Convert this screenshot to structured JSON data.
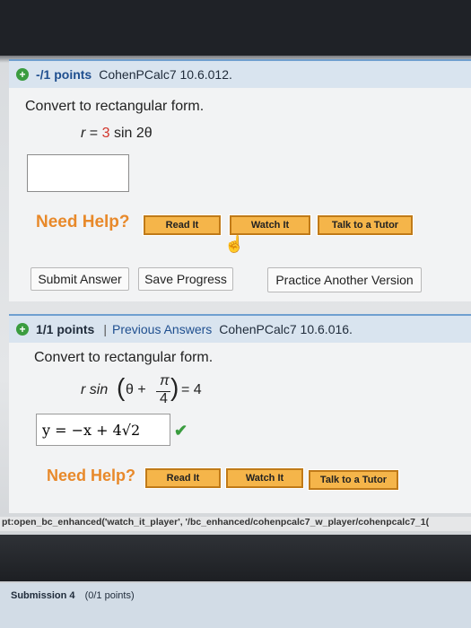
{
  "q1": {
    "points": "-/1 points",
    "course_code": "CohenPCalc7 10.6.012.",
    "question": "Convert to rectangular form.",
    "eq_r": "r",
    "eq_equals": "=",
    "eq_value": "3",
    "eq_func": "sin 2θ",
    "answer_value": "",
    "need_help": "Need Help?",
    "read_it": "Read It",
    "watch_it": "Watch It",
    "talk_tutor": "Talk to a Tutor",
    "submit": "Submit Answer",
    "save": "Save Progress",
    "practice": "Practice Another Version"
  },
  "q2": {
    "points": "1/1 points",
    "separator": "|",
    "previous_answers": "Previous Answers",
    "course_code": "CohenPCalc7 10.6.016.",
    "question": "Convert to rectangular form.",
    "eq_left": "r sin",
    "eq_theta": "θ +",
    "eq_frac_num": "π",
    "eq_frac_den": "4",
    "eq_right": "= 4",
    "answer": "y = −x + 4√2",
    "need_help": "Need Help?",
    "read_it": "Read It",
    "watch_it": "Watch It",
    "talk_tutor": "Talk to a Tutor"
  },
  "status_bar": "pt:open_bc_enhanced('watch_it_player', '/bc_enhanced/cohenpcalc7_w_player/cohenpcalc7_1(",
  "q4": {
    "label": "Submission 4",
    "points": "(0/1 points)"
  }
}
